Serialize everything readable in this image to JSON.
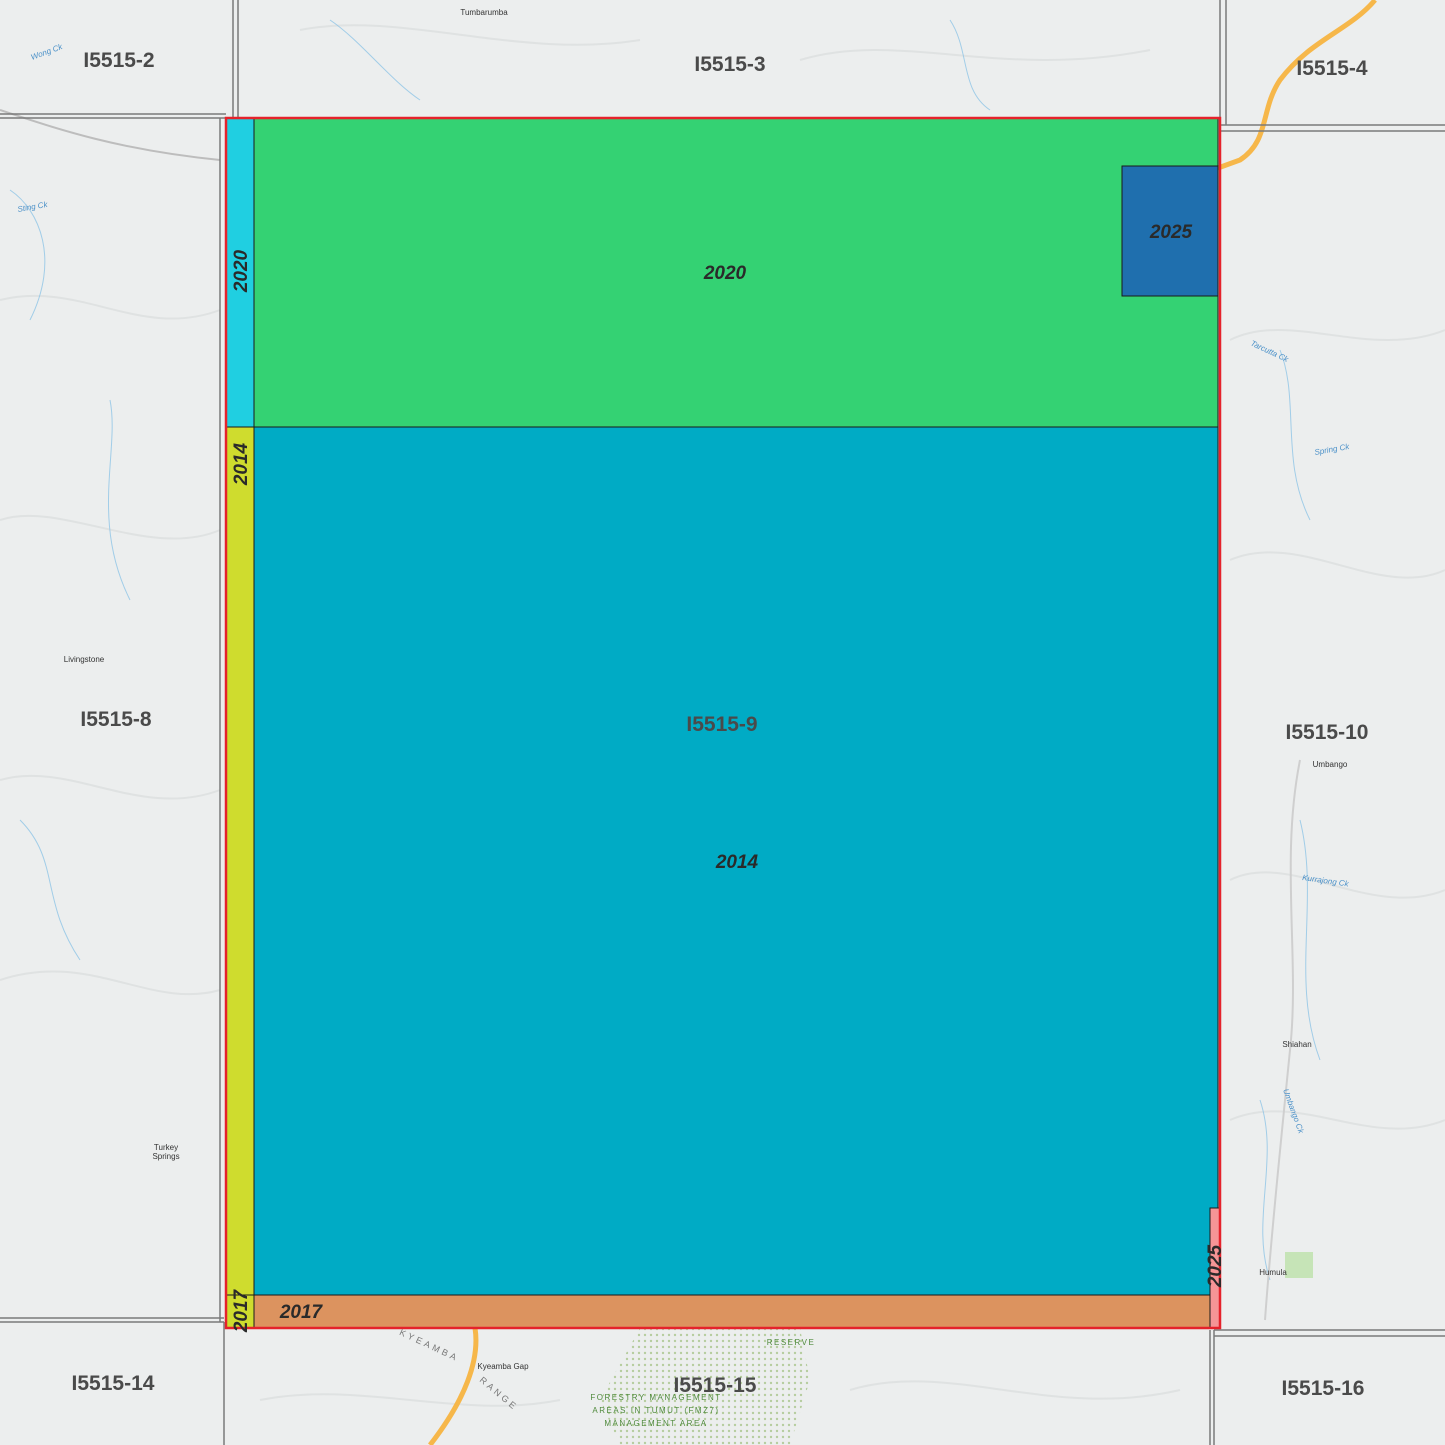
{
  "map": {
    "tile_labels": {
      "nw": "I5515-2",
      "n": "I5515-3",
      "ne": "I5515-4",
      "w": "I5515-8",
      "center": "I5515-9",
      "e": "I5515-10",
      "sw": "I5515-14",
      "s": "I5515-15",
      "se": "I5515-16"
    },
    "capture_years": {
      "top_main": "2020",
      "top_left_strip": "2020",
      "corner_block": "2025",
      "main": "2014",
      "left_strip": "2014",
      "bottom_strip": "2017",
      "bottom_left_corner": "2017",
      "right_sliver": "2025"
    },
    "place_names": {
      "tumbarumba_north": "Tumbarumba",
      "livingstone": "Livingstone",
      "turkey": "Turkey",
      "springs": "Springs",
      "umbango": "Umbango",
      "shiahan": "Shiahan",
      "humula": "Humula",
      "kyeamba_gap": "Kyeamba Gap",
      "range_name": "KYEAMBA",
      "range_word": "RANGE",
      "reserve": "RESERVE",
      "fma_line1": "FORESTRY MANAGEMENT",
      "fma_line2": "AREAS IN TUMUT (FMZ7)",
      "fma_line3": "MANAGEMENT AREA"
    },
    "water_names": {
      "wong_ck": "Wong Ck",
      "sting_ck": "Sting Ck",
      "umbango_ck": "Umbango Ck",
      "spring_ck": "Spring Ck",
      "tarcutta_ck": "Tarcutta Ck",
      "kurrajong_ck": "Kurrajong Ck"
    },
    "colors": {
      "green_2020": "#34d273",
      "cyan_2020": "#20cfe1",
      "blue_2025": "#1f6fae",
      "teal_2014": "#00abc5",
      "lime_2014": "#cfdc2e",
      "orange_2017": "#dc935f",
      "pink_2025": "#f59596",
      "selection_border": "#e5222b",
      "road": "#f6b74a"
    }
  }
}
